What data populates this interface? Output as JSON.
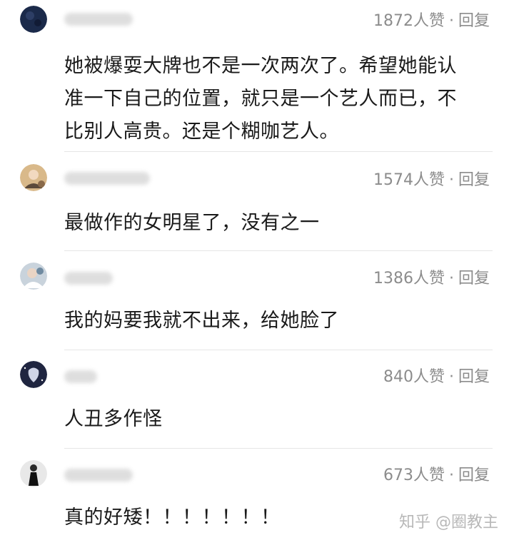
{
  "comments": [
    {
      "likes": "1872人赞",
      "dot": "·",
      "reply": "回复",
      "text_lines": [
        "她被爆耍大牌也不是一次两次了。希望她能认",
        "准一下自己的位置，就只是一个艺人而已，不",
        "比别人高贵。还是个糊咖艺人。"
      ]
    },
    {
      "likes": "1574人赞",
      "dot": "·",
      "reply": "回复",
      "text_lines": [
        "最做作的女明星了，没有之一"
      ]
    },
    {
      "likes": "1386人赞",
      "dot": "·",
      "reply": "回复",
      "text_lines": [
        "我的妈要我就不出来，给她脸了"
      ]
    },
    {
      "likes": "840人赞",
      "dot": "·",
      "reply": "回复",
      "text_lines": [
        "人丑多作怪"
      ]
    },
    {
      "likes": "673人赞",
      "dot": "·",
      "reply": "回复",
      "text_lines": [
        "真的好矮！！！！！！！"
      ]
    }
  ],
  "watermark": "知乎 @圈教主",
  "colors": {
    "meta": "#8c8c8c",
    "text": "#1a1a1a",
    "divider": "#e6e6e6",
    "watermark": "#b8b8b8"
  }
}
